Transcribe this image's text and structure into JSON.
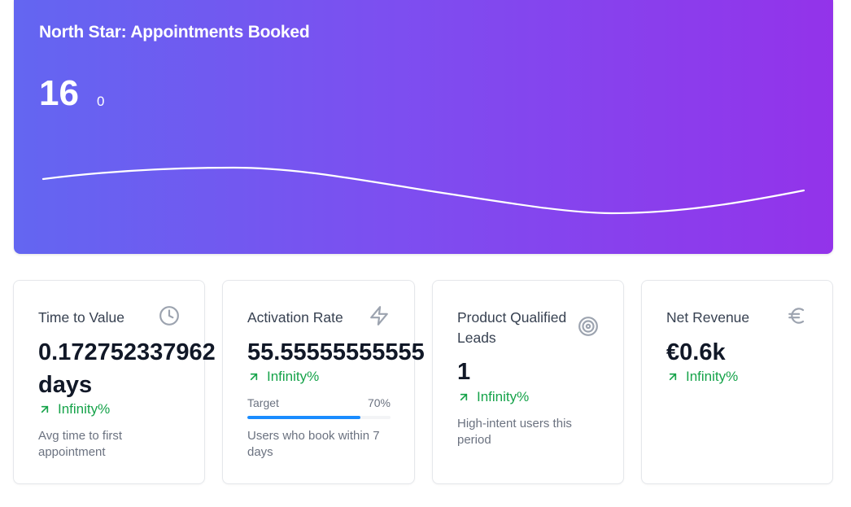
{
  "hero": {
    "title": "North Star: Appointments Booked",
    "value": "16",
    "delta": "0"
  },
  "cards": [
    {
      "title": "Time to Value",
      "icon": "clock-icon",
      "value_line1": "0.172752337962",
      "value_line2": "days",
      "trend": "Infinity%",
      "description": "Avg time to first appointment"
    },
    {
      "title": "Activation Rate",
      "icon": "zap-icon",
      "value": "55.55555555555",
      "trend": "Infinity%",
      "target_label": "Target",
      "target_value": "70%",
      "progress_fraction": 0.79,
      "description": "Users who book within 7 days"
    },
    {
      "title": "Product Qualified Leads",
      "icon": "target-icon",
      "value": "1",
      "trend": "Infinity%",
      "description": "High-intent users this period"
    },
    {
      "title": "Net Revenue",
      "icon": "euro-icon",
      "value": "€0.6k",
      "trend": "Infinity%"
    }
  ],
  "colors": {
    "gradient_start": "#6366f1",
    "gradient_end": "#9333ea",
    "positive": "#16a34a",
    "progress": "#1a8cff"
  }
}
